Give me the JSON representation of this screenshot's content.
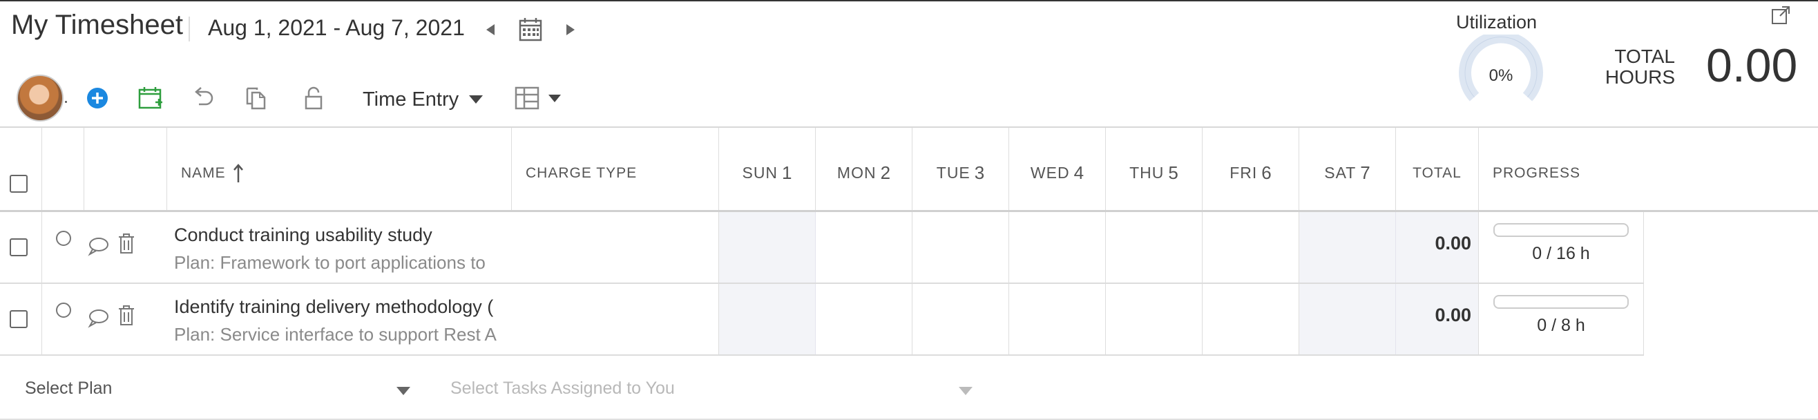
{
  "header": {
    "title": "My Timesheet",
    "date_range": "Aug 1, 2021 - Aug 7, 2021",
    "icons": [
      "chevron-left-icon",
      "calendar-icon",
      "chevron-right-icon",
      "expand-icon"
    ]
  },
  "toolbar": {
    "time_entry_label": "Time Entry",
    "icons": [
      "avatar",
      "add-icon",
      "calendar-add-icon",
      "undo-icon",
      "copy-icon",
      "lock-icon",
      "grid-layout-icon"
    ]
  },
  "summary": {
    "utilization_label": "Utilization",
    "utilization_value": "0%",
    "utilization_fraction": 0,
    "total_hours_label_line1": "TOTAL",
    "total_hours_label_line2": "HOURS",
    "total_hours_value": "0.00"
  },
  "table": {
    "columns": {
      "name": "NAME",
      "charge_type": "CHARGE TYPE",
      "days": [
        {
          "day": "SUN",
          "num": "1"
        },
        {
          "day": "MON",
          "num": "2"
        },
        {
          "day": "TUE",
          "num": "3"
        },
        {
          "day": "WED",
          "num": "4"
        },
        {
          "day": "THU",
          "num": "5"
        },
        {
          "day": "FRI",
          "num": "6"
        },
        {
          "day": "SAT",
          "num": "7"
        }
      ],
      "total": "TOTAL",
      "progress": "PROGRESS"
    },
    "rows": [
      {
        "name": "Conduct training usability study",
        "plan": "Plan: Framework to port applications to",
        "total": "0.00",
        "progress_text": "0 / 16 h",
        "progress_fraction": 0
      },
      {
        "name": "Identify training delivery methodology (",
        "plan": "Plan: Service interface to support Rest A",
        "total": "0.00",
        "progress_text": "0 / 8 h",
        "progress_fraction": 0
      }
    ]
  },
  "footer": {
    "select_plan": "Select Plan",
    "select_tasks": "Select Tasks Assigned to You"
  },
  "colors": {
    "accent_blue": "#1b88e0",
    "calendar_green": "#2e9e3e",
    "gauge_track": "#dde6f2",
    "weekend_shade": "#f3f4f8"
  }
}
